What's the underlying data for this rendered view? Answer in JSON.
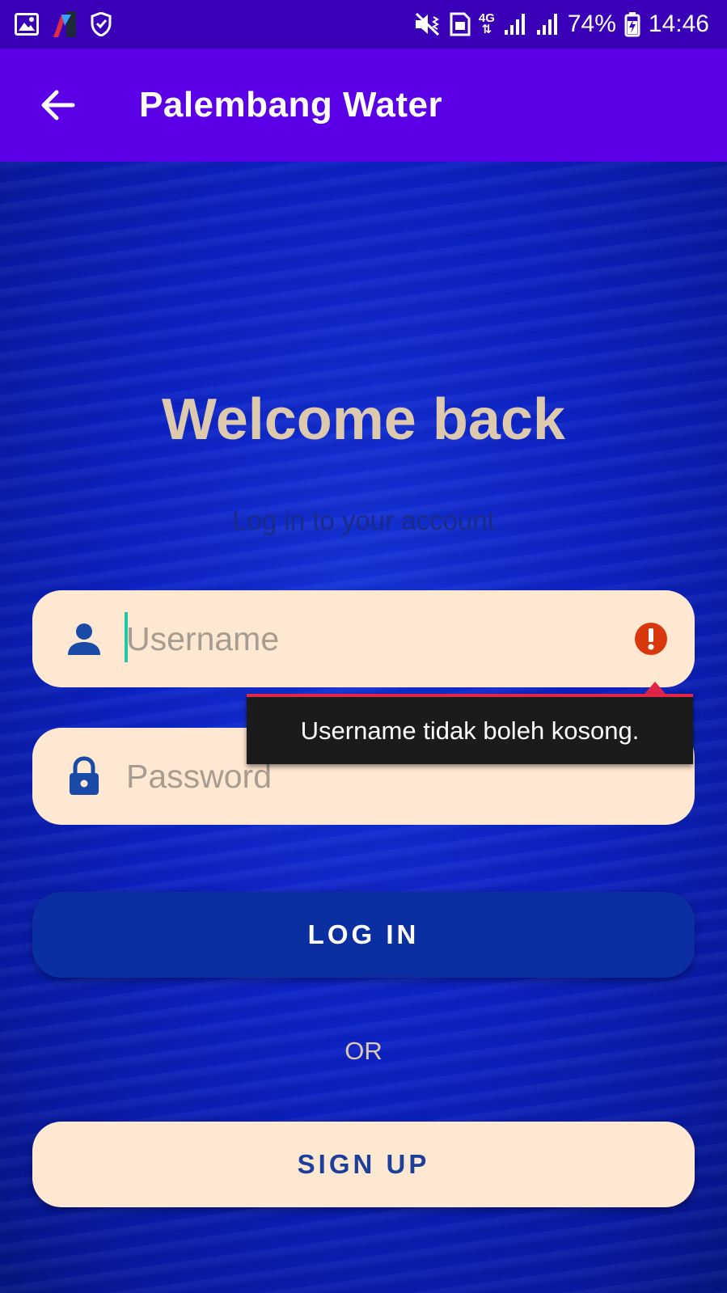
{
  "status_bar": {
    "left_icons": [
      "image-icon",
      "app-logo-icon",
      "shield-icon"
    ],
    "right_icons": [
      "vibrate-mute-icon",
      "sim-icon",
      "network-4g-icon",
      "signal-icon",
      "signal-icon"
    ],
    "network": "4G",
    "battery": "74%",
    "time": "14:46"
  },
  "app_bar": {
    "title": "Palembang Water",
    "back_icon": "arrow-left-icon"
  },
  "login": {
    "welcome": "Welcome back",
    "subtitle": "Log in to your account",
    "username_placeholder": "Username",
    "password_placeholder": "Password",
    "error_message": "Username tidak boleh kosong.",
    "login_label": "LOG IN",
    "or_label": "OR",
    "signup_label": "SIGN UP"
  },
  "colors": {
    "status_bar": "#3a00b8",
    "app_bar": "#5b00e6",
    "field_bg": "#ffe8d1",
    "welcome_text": "#ddc9ad",
    "login_button": "#0b2fa0",
    "error_red": "#d9380f",
    "cursor": "#1dc7a7"
  }
}
